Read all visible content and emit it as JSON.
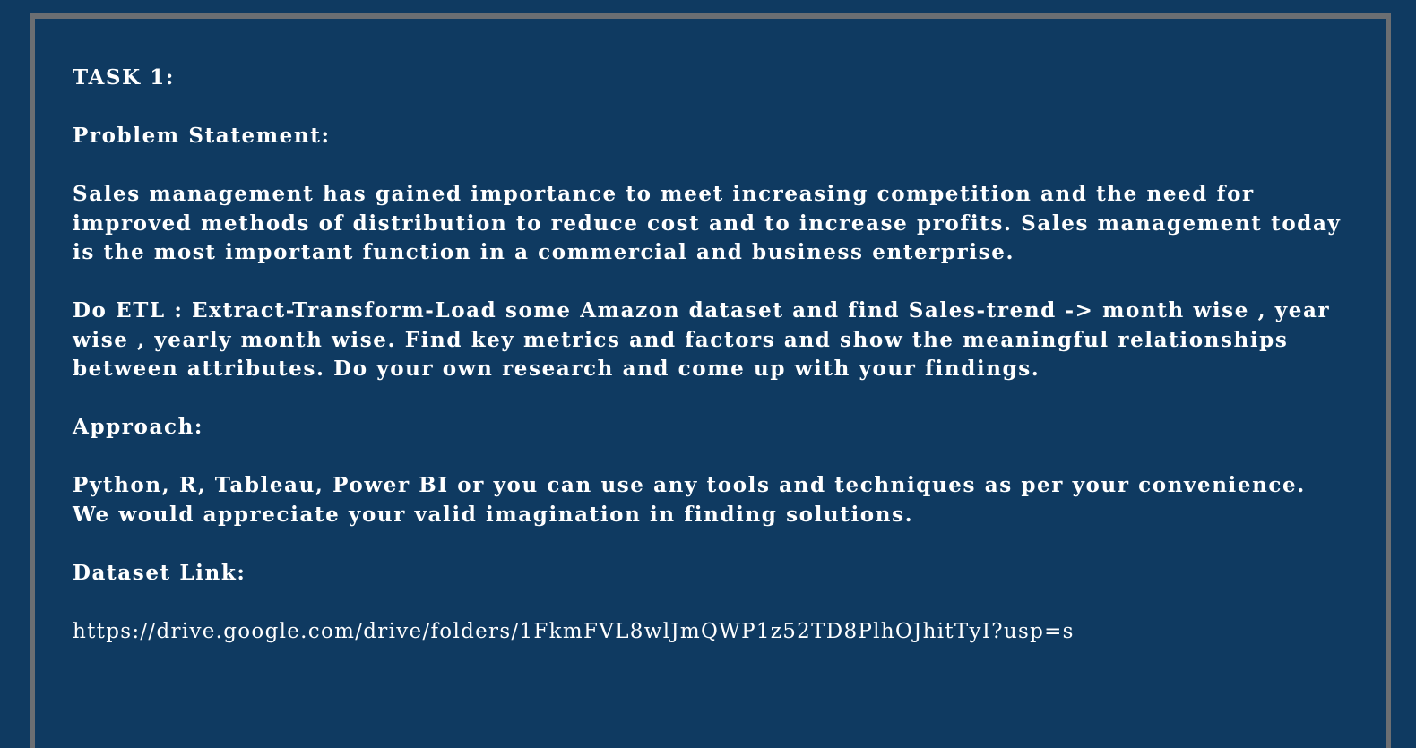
{
  "task_title": "TASK 1:",
  "problem_heading": "Problem Statement:",
  "problem_paragraph_1": "Sales management has gained importance to meet increasing competition and the need for improved methods of distribution to reduce cost and to increase profits. Sales management today is the most important function in a commercial and business enterprise.",
  "problem_paragraph_2": "Do ETL : Extract-Transform-Load some Amazon dataset and find Sales-trend -> month wise , year wise , yearly month wise. Find key metrics and factors and show the meaningful relationships between attributes. Do your own research and come up with your findings.",
  "approach_heading": "Approach:",
  "approach_paragraph": "Python, R, Tableau, Power BI or you can use any tools and techniques as per your convenience. We would appreciate your valid imagination in finding solutions.",
  "dataset_heading": "Dataset Link:",
  "dataset_link": "https://drive.google.com/drive/folders/1FkmFVL8wlJmQWP1z52TD8PlhOJhitTyI?usp=s",
  "colors": {
    "background": "#0f3a61",
    "border": "#6b6e72",
    "text": "#ffffff"
  }
}
